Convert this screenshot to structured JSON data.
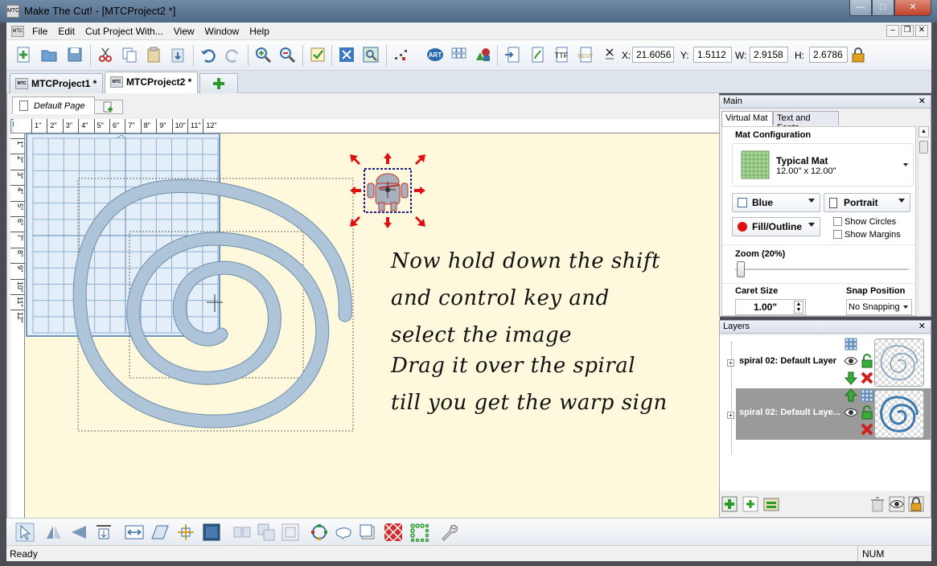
{
  "window": {
    "title": "Make The Cut! - [MTCProject2 *]",
    "app_icon_text": "MTC",
    "controls": {
      "minimize": "—",
      "maximize": "□",
      "close": "✕"
    }
  },
  "menu": {
    "items": [
      "File",
      "Edit",
      "Cut Project With...",
      "View",
      "Window",
      "Help"
    ],
    "mdi": {
      "minimize": "–",
      "restore": "❐",
      "close": "✕"
    }
  },
  "toolbar": {
    "coords": {
      "x_label": "X:",
      "x": "21.6056",
      "y_label": "Y:",
      "y": "1.5112",
      "w_label": "W:",
      "w": "2.9158",
      "h_label": "H:",
      "h": "2.6786"
    },
    "icons": [
      "new-document",
      "open-folder",
      "save",
      "cut",
      "copy",
      "paste",
      "paste-special",
      "undo",
      "redo",
      "zoom-in",
      "zoom-out",
      "checklist",
      "mat-settings",
      "zoom-window",
      "snap-points",
      "art",
      "grid-layout",
      "shapes",
      "import-doc",
      "trace",
      "text-tool",
      "svg-import",
      "chain-link",
      "lock"
    ]
  },
  "doc_tabs": [
    {
      "label": "MTCProject1 *",
      "active": false
    },
    {
      "label": "MTCProject2 *",
      "active": true
    }
  ],
  "page_tab": {
    "label": "Default Page"
  },
  "ruler": {
    "h_marks": [
      "1\"",
      "2\"",
      "3\"",
      "4\"",
      "5\"",
      "6\"",
      "7\"",
      "8\"",
      "9\"",
      "10\"",
      "11\"",
      "12\""
    ],
    "v_marks": [
      "1\"",
      "2\"",
      "3\"",
      "4\"",
      "5\"",
      "6\"",
      "7\"",
      "8\"",
      "9\"",
      "10\"",
      "11\"",
      "12\""
    ]
  },
  "canvas": {
    "instructions": [
      "Now hold down the shift",
      "and control key and",
      "select the  image",
      "Drag it over the spiral",
      "till you get the warp sign"
    ]
  },
  "main_panel": {
    "title": "Main",
    "close": "✕",
    "tabs": [
      "Virtual Mat",
      "Text and Fonts"
    ],
    "mat_config_title": "Mat Configuration",
    "mat_name": "Typical Mat",
    "mat_size": "12.00\" x 12.00\"",
    "color_select": "Blue",
    "orientation_select": "Portrait",
    "display_select": "Fill/Outline",
    "show_circles": "Show Circles",
    "show_margins": "Show Margins",
    "zoom_title": "Zoom (20%)",
    "zoom_percent": 0.2,
    "caret_title": "Caret Size",
    "caret_value": "1.00\"",
    "snap_title": "Snap Position",
    "snap_value": "No Snapping"
  },
  "layers_panel": {
    "title": "Layers",
    "close": "✕",
    "layers": [
      {
        "name": "spiral 02: Default Layer",
        "selected": false
      },
      {
        "name": "spiral 02: Default Laye...",
        "selected": true
      }
    ]
  },
  "status": {
    "left": "Ready",
    "right": "NUM"
  },
  "colors": {
    "accent": "#3a6ea5",
    "mat_grid": "#7aa3cc",
    "canvas": "#fef9dc",
    "spiral": "#a9c2dc",
    "selected_layer": "#9a9a9a"
  }
}
